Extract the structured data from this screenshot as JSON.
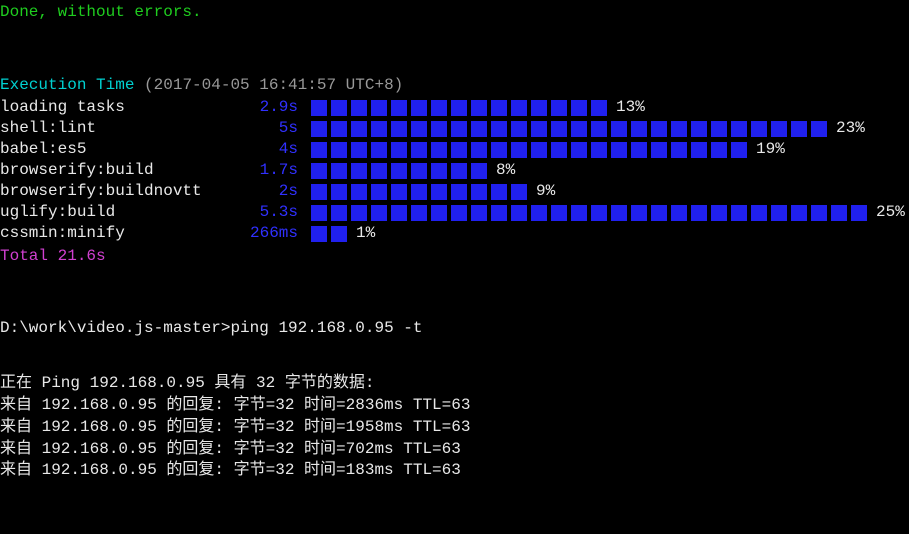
{
  "status": {
    "done_message": "Done, without errors."
  },
  "execution": {
    "header_label": "Execution Time",
    "timestamp": "(2017-04-05 16:41:57 UTC+8)",
    "tasks": [
      {
        "name": "loading tasks",
        "time": "2.9s",
        "blocks": 15,
        "pct": "13%"
      },
      {
        "name": "shell:lint",
        "time": "5s",
        "blocks": 26,
        "pct": "23%"
      },
      {
        "name": "babel:es5",
        "time": "4s",
        "blocks": 22,
        "pct": "19%"
      },
      {
        "name": "browserify:build",
        "time": "1.7s",
        "blocks": 9,
        "pct": "8%"
      },
      {
        "name": "browserify:buildnovtt",
        "time": "2s",
        "blocks": 11,
        "pct": "9%"
      },
      {
        "name": "uglify:build",
        "time": "5.3s",
        "blocks": 28,
        "pct": "25%"
      },
      {
        "name": "cssmin:minify",
        "time": "266ms",
        "blocks": 2,
        "pct": "1%"
      }
    ],
    "total": "Total 21.6s"
  },
  "prompt": {
    "path": "D:\\work\\video.js-master>",
    "command": "ping 192.168.0.95 -t"
  },
  "ping": {
    "header": "正在 Ping 192.168.0.95 具有 32 字节的数据:",
    "replies": [
      "来自 192.168.0.95 的回复: 字节=32 时间=2836ms TTL=63",
      "来自 192.168.0.95 的回复: 字节=32 时间=1958ms TTL=63",
      "来自 192.168.0.95 的回复: 字节=32 时间=702ms TTL=63",
      "来自 192.168.0.95 的回复: 字节=32 时间=183ms TTL=63"
    ]
  },
  "chart_data": {
    "type": "bar",
    "title": "Execution Time",
    "categories": [
      "loading tasks",
      "shell:lint",
      "babel:es5",
      "browserify:build",
      "browserify:buildnovtt",
      "uglify:build",
      "cssmin:minify"
    ],
    "series": [
      {
        "name": "seconds",
        "values": [
          2.9,
          5,
          4,
          1.7,
          2,
          5.3,
          0.266
        ]
      },
      {
        "name": "percent",
        "values": [
          13,
          23,
          19,
          8,
          9,
          25,
          1
        ]
      }
    ],
    "total_seconds": 21.6
  }
}
